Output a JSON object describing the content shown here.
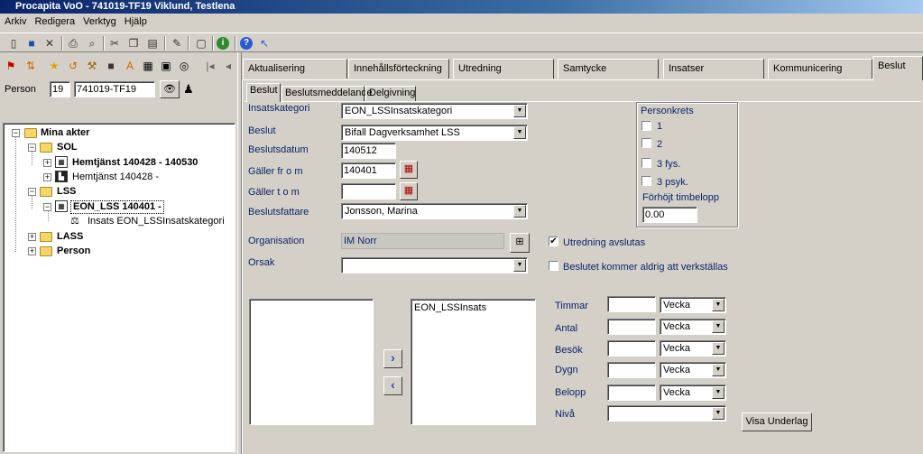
{
  "window": {
    "title": "Procapita VoO - 741019-TF19 Viklund, Testlena"
  },
  "menu": [
    "Arkiv",
    "Redigera",
    "Verktyg",
    "Hjälp"
  ],
  "toolbar_icons": [
    "new-icon",
    "save-icon",
    "delete-icon",
    "print-icon",
    "find-icon",
    "cut-icon",
    "copy-icon",
    "paste-icon",
    "pin-icon",
    "page-icon",
    "info-icon",
    "help-icon",
    "whatsthis-icon"
  ],
  "person": {
    "label": "Person",
    "nr_prefix": "19",
    "id": "741019-TF19"
  },
  "tree": {
    "root": "Mina akter",
    "sol": "SOL",
    "hemtjanst1": "Hemtjänst 140428 - 140530",
    "hemtjanst2": "Hemtjänst 140428 -",
    "lss": "LSS",
    "eon": "EON_LSS 140401 -",
    "insats": "Insats EON_LSSInsatskategori",
    "lass": "LASS",
    "personfolder": "Person"
  },
  "tabs": [
    "Aktualisering",
    "Innehållsförteckning",
    "Utredning",
    "Samtycke",
    "Insatser",
    "Kommunicering",
    "Beslut"
  ],
  "subtabs": [
    "Beslut",
    "Beslutsmeddelande",
    "Delgivning"
  ],
  "form": {
    "insatskategori_label": "Insatskategori",
    "insatskategori_value": "EON_LSSInsatskategori",
    "beslut_label": "Beslut",
    "beslut_value": "Bifall Dagverksamhet LSS",
    "beslutsdatum_label": "Beslutsdatum",
    "beslutsdatum_value": "140512",
    "galler_from_label": "Gäller fr o m",
    "galler_from_value": "140401",
    "galler_tom_label": "Gäller t o m",
    "galler_tom_value": "",
    "beslutsfattare_label": "Beslutsfattare",
    "beslutsfattare_value": "Jonsson, Marina",
    "organisation_label": "Organisation",
    "organisation_value": "IM Norr",
    "orsak_label": "Orsak",
    "orsak_value": ""
  },
  "personkrets": {
    "title": "Personkrets",
    "options": [
      "1",
      "2",
      "3 fys.",
      "3 psyk."
    ],
    "forhojt_label": "Förhöjt timbelopp",
    "forhojt_value": "0.00"
  },
  "checks": {
    "utredning_label": "Utredning avslutas",
    "utredning_checked": true,
    "aldrig_label": "Beslutet kommer aldrig att verkställas",
    "aldrig_checked": false
  },
  "insats_list": [
    "EON_LSSInsats"
  ],
  "measures": [
    {
      "label": "Timmar",
      "value": "",
      "unit": "Vecka"
    },
    {
      "label": "Antal",
      "value": "",
      "unit": "Vecka"
    },
    {
      "label": "Besök",
      "value": "",
      "unit": "Vecka"
    },
    {
      "label": "Dygn",
      "value": "",
      "unit": "Vecka"
    },
    {
      "label": "Belopp",
      "value": "",
      "unit": "Vecka"
    }
  ],
  "niva_label": "Nivå",
  "niva_value": "",
  "visa_underlag": "Visa Underlag"
}
